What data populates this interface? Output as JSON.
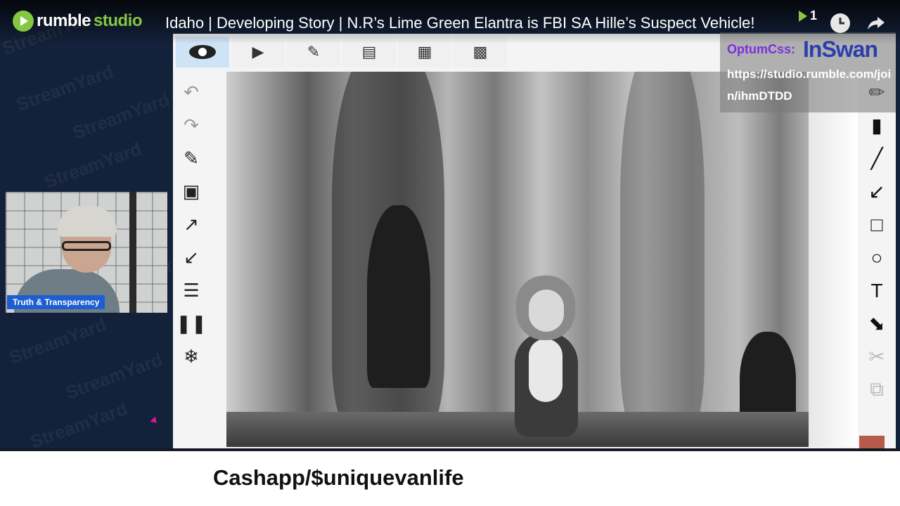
{
  "header": {
    "logo_word1": "rumble",
    "logo_word2": "studio",
    "stream_title": "Idaho | Developing Story | N.R’s Lime Green Elantra is FBI SA Hille’s Suspect Vehicle!",
    "viewer_count": "1"
  },
  "background_watermarks": [
    "StreamYard",
    "StreamYard",
    "StreamYard",
    "StreamYard",
    "StreamYard",
    "StreamYard",
    "StreamYard",
    "StreamYard"
  ],
  "webcam": {
    "name_label": "Truth & Transparency"
  },
  "whiteboard": {
    "top_tools": [
      "eye-icon",
      "play-icon",
      "annotate-icon",
      "text-recognition-icon",
      "scan-document-icon",
      "qr-code-icon"
    ],
    "left_tools": [
      "undo-icon",
      "redo-icon",
      "edit-selection-icon",
      "camera-icon",
      "import-image-icon",
      "export-image-icon",
      "adjust-icon",
      "pause-icon",
      "freeze-icon"
    ],
    "right_tools": [
      "pencil-icon",
      "eraser-icon",
      "line-icon",
      "arrow-icon",
      "rectangle-icon",
      "circle-icon",
      "text-icon",
      "select-icon",
      "cut-icon",
      "copy-icon"
    ]
  },
  "overlay": {
    "label": "OptumCss:",
    "brand": "InSwan",
    "url": "https://studio.rumble.com/join/ihmDTDD"
  },
  "banner": {
    "text": "Cashapp/$uniquevanlife"
  },
  "colors": {
    "rumble_green": "#85c742",
    "banner_bg": "#ffffff",
    "label_blue": "#1d5fd0",
    "optum_purple": "#7a2fe0"
  }
}
